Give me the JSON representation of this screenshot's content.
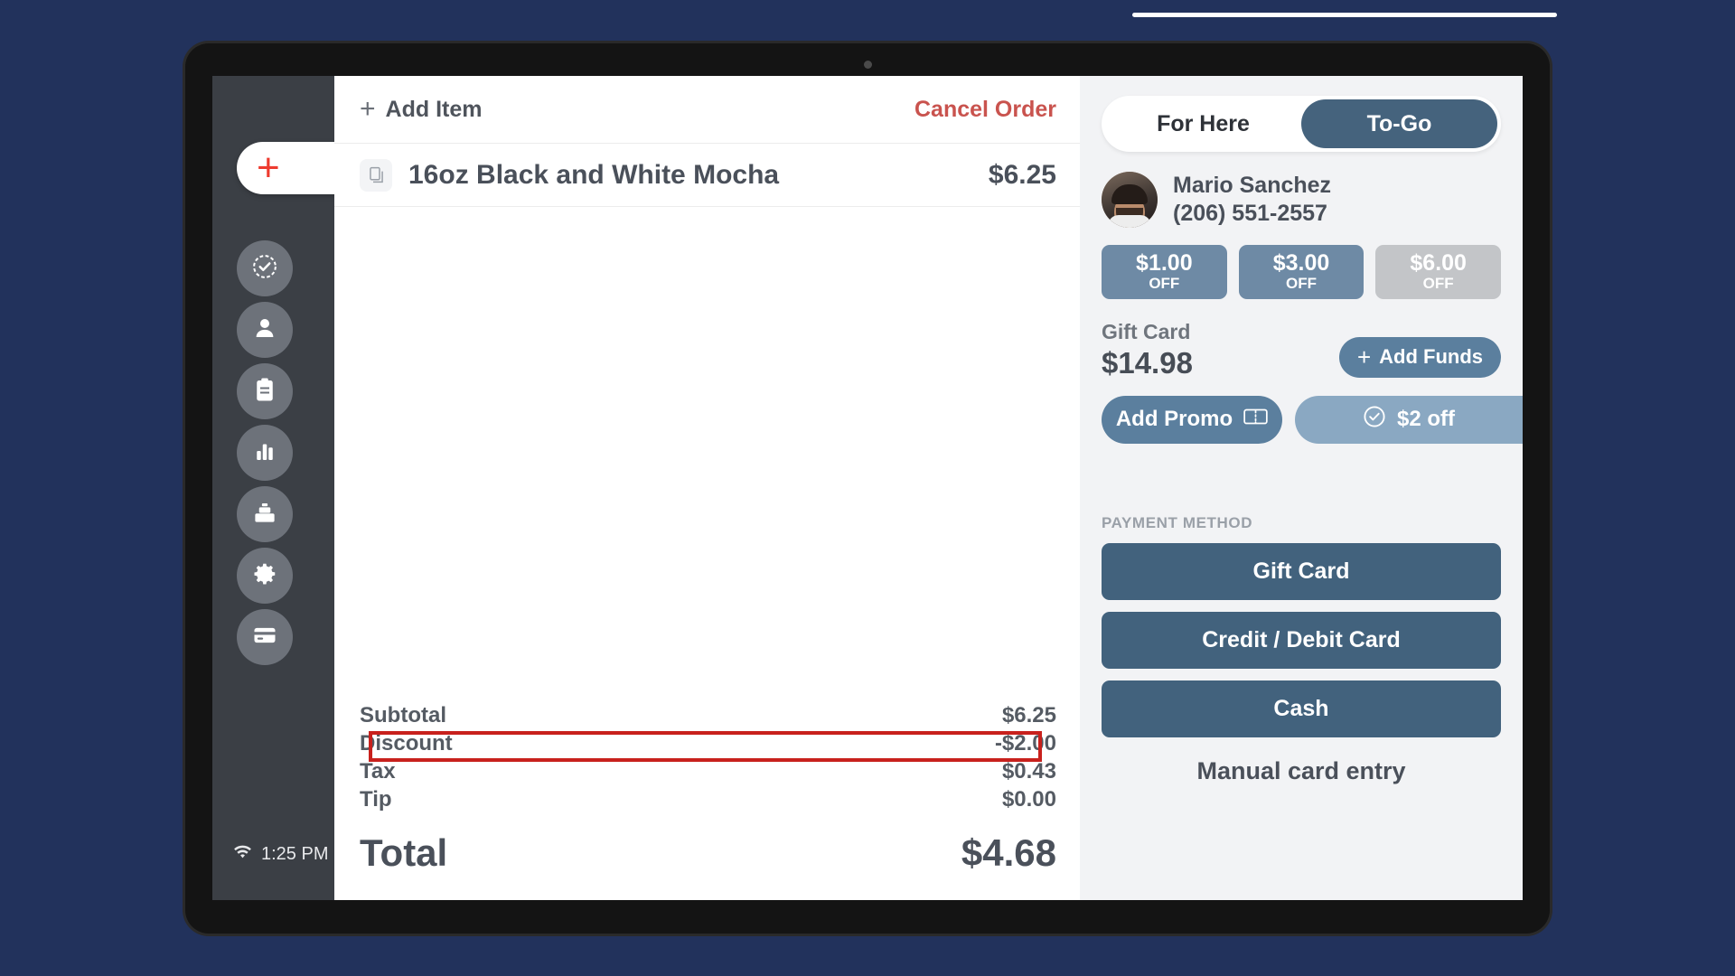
{
  "rail": {
    "add_label": "+",
    "items": [
      {
        "icon": "checkmark-badge-icon"
      },
      {
        "icon": "person-icon"
      },
      {
        "icon": "clipboard-icon"
      },
      {
        "icon": "bar-chart-icon"
      },
      {
        "icon": "cash-register-icon"
      },
      {
        "icon": "gear-icon"
      },
      {
        "icon": "credit-card-icon"
      }
    ],
    "wifi_icon": "wifi-icon",
    "time": "1:25 PM"
  },
  "order": {
    "add_item_sign": "+",
    "add_item_label": "Add Item",
    "cancel_label": "Cancel Order",
    "items": [
      {
        "icon": "document-icon",
        "name": "16oz Black and White Mocha",
        "price": "$6.25"
      }
    ],
    "totals": [
      {
        "label": "Subtotal",
        "value": "$6.25"
      },
      {
        "label": "Discount",
        "value": "-$2.00"
      },
      {
        "label": "Tax",
        "value": "$0.43"
      },
      {
        "label": "Tip",
        "value": "$0.00"
      }
    ],
    "grand_label": "Total",
    "grand_value": "$4.68",
    "highlight_color": "#c8211d",
    "highlighted_row": "Discount"
  },
  "side": {
    "mode": {
      "for_here": "For Here",
      "to_go": "To-Go",
      "selected": "To-Go"
    },
    "customer": {
      "avatar": "customer-avatar",
      "name": "Mario Sanchez",
      "phone": "(206) 551-2557"
    },
    "discount_chips": [
      {
        "amount": "$1.00",
        "off": "OFF",
        "state": "active"
      },
      {
        "amount": "$3.00",
        "off": "OFF",
        "state": "active"
      },
      {
        "amount": "$6.00",
        "off": "OFF",
        "state": "dim"
      }
    ],
    "gift_card": {
      "label": "Gift Card",
      "amount": "$14.98",
      "add_funds_sign": "+",
      "add_funds_label": "Add Funds"
    },
    "promo": {
      "add_label": "Add Promo",
      "add_icon": "ticket-icon",
      "applied_label": "$2 off",
      "applied_icon": "check-circle-icon"
    },
    "payment": {
      "section_label": "PAYMENT METHOD",
      "methods": [
        {
          "label": "Gift Card"
        },
        {
          "label": "Credit / Debit Card"
        },
        {
          "label": "Cash"
        }
      ],
      "manual_entry": "Manual card entry"
    }
  },
  "theme": {
    "page_background": "#22325c",
    "accent_blue": "#45637d",
    "chip_blue": "#6e8aa5",
    "chip_dim": "#c3c5c8",
    "cancel_red": "#c9534e",
    "rail_dark": "#3b3f45"
  }
}
